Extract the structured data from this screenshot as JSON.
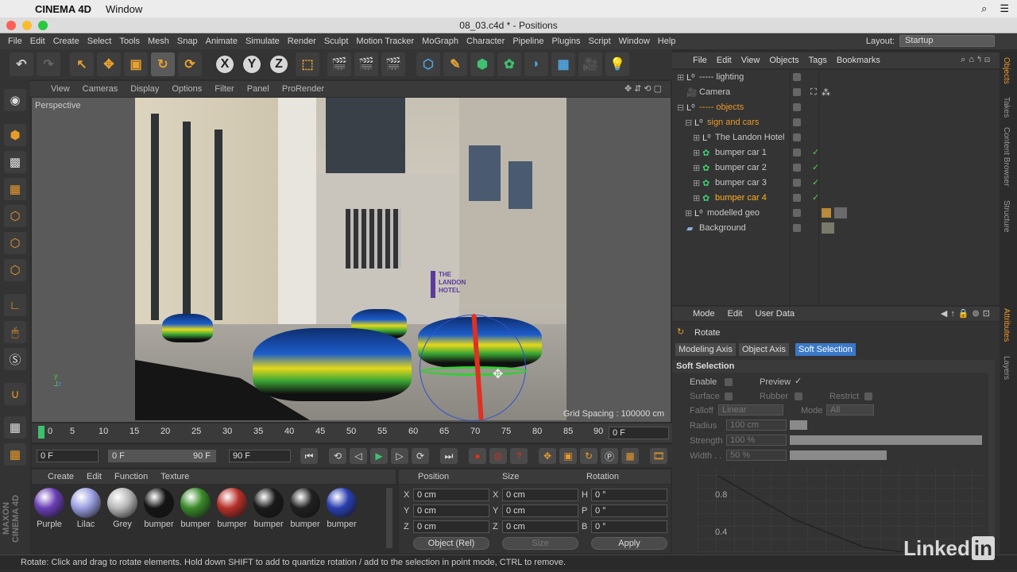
{
  "mac": {
    "app": "CINEMA 4D",
    "menu": "Window"
  },
  "window": {
    "title": "08_03.c4d * - Positions"
  },
  "menu": [
    "File",
    "Edit",
    "Create",
    "Select",
    "Tools",
    "Mesh",
    "Snap",
    "Animate",
    "Simulate",
    "Render",
    "Sculpt",
    "Motion Tracker",
    "MoGraph",
    "Character",
    "Pipeline",
    "Plugins",
    "Script",
    "Window",
    "Help"
  ],
  "layout": {
    "label": "Layout:",
    "value": "Startup"
  },
  "viewport": {
    "menu": [
      "View",
      "Cameras",
      "Display",
      "Options",
      "Filter",
      "Panel",
      "ProRender"
    ],
    "label": "Perspective",
    "grid": "Grid Spacing : 100000 cm",
    "sign": "THE LANDON HOTEL"
  },
  "timeline": {
    "ticks": [
      "0",
      "5",
      "10",
      "15",
      "20",
      "25",
      "30",
      "35",
      "40",
      "45",
      "50",
      "55",
      "60",
      "65",
      "70",
      "75",
      "80",
      "85",
      "90"
    ],
    "current": "0 F"
  },
  "transport": {
    "start": "0 F",
    "min": "0 F",
    "max": "90 F",
    "end": "90 F"
  },
  "materials": {
    "menu": [
      "Create",
      "Edit",
      "Function",
      "Texture"
    ],
    "items": [
      {
        "name": "Purple",
        "color": "#6a3fb5"
      },
      {
        "name": "Lilac",
        "color": "#9a9ee0"
      },
      {
        "name": "Grey",
        "color": "#b8b8b8"
      },
      {
        "name": "bumper",
        "color": "#151515"
      },
      {
        "name": "bumper",
        "color": "#3a8a2a"
      },
      {
        "name": "bumper",
        "color": "#b8302a"
      },
      {
        "name": "bumper",
        "color": "#1a1a1a"
      },
      {
        "name": "bumper",
        "color": "#202020"
      },
      {
        "name": "bumper",
        "color": "#2a3fb0"
      }
    ]
  },
  "coords": {
    "headers": [
      "Position",
      "Size",
      "Rotation"
    ],
    "rows": [
      {
        "axis": "X",
        "pos": "0 cm",
        "saxis": "X",
        "size": "0 cm",
        "raxis": "H",
        "rot": "0 °"
      },
      {
        "axis": "Y",
        "pos": "0 cm",
        "saxis": "Y",
        "size": "0 cm",
        "raxis": "P",
        "rot": "0 °"
      },
      {
        "axis": "Z",
        "pos": "0 cm",
        "saxis": "Z",
        "size": "0 cm",
        "raxis": "B",
        "rot": "0 °"
      }
    ],
    "mode": "Object (Rel)",
    "size_mode": "Size",
    "apply": "Apply"
  },
  "status": "Rotate: Click and drag to rotate elements. Hold down SHIFT to add to quantize rotation / add to the selection in point mode, CTRL to remove.",
  "objects": {
    "menu": [
      "File",
      "Edit",
      "View",
      "Objects",
      "Tags",
      "Bookmarks"
    ],
    "items": [
      {
        "name": "----- lighting",
        "color": "#c8c8c8"
      },
      {
        "name": "Camera",
        "color": "#c8c8c8"
      },
      {
        "name": "----- objects",
        "color": "#e89a2a"
      },
      {
        "name": "sign and cars",
        "color": "#e89a2a"
      },
      {
        "name": "The Landon Hotel",
        "color": "#c8c8c8"
      },
      {
        "name": "bumper car 1",
        "color": "#c8c8c8"
      },
      {
        "name": "bumper car 2",
        "color": "#c8c8c8"
      },
      {
        "name": "bumper car 3",
        "color": "#c8c8c8"
      },
      {
        "name": "bumper car 4",
        "color": "#ffb020"
      },
      {
        "name": "modelled geo",
        "color": "#c8c8c8"
      },
      {
        "name": "Background",
        "color": "#c8c8c8"
      }
    ]
  },
  "attributes": {
    "menu": [
      "Mode",
      "Edit",
      "User Data"
    ],
    "title": "Rotate",
    "tabs": [
      "Modeling Axis",
      "Object Axis",
      "Soft Selection"
    ],
    "section": "Soft Selection",
    "enable": "Enable",
    "preview": "Preview",
    "surface": "Surface",
    "rubber": "Rubber",
    "restrict": "Restrict",
    "falloff": "Falloff",
    "falloff_value": "Linear",
    "mode": "Mode",
    "mode_value": "All",
    "radius": "Radius",
    "radius_value": "100 cm",
    "strength": "Strength",
    "strength_value": "100 %",
    "width": "Width . .",
    "width_value": "50 %",
    "graph_labels": [
      "0.8",
      "0.4"
    ]
  },
  "righttabs": [
    "Objects",
    "Takes",
    "Content Browser",
    "Structure",
    "Attributes",
    "Layers"
  ],
  "maxon": "MAXON CINEMA 4D",
  "brand": {
    "name": "Linked",
    "badge": "in"
  }
}
